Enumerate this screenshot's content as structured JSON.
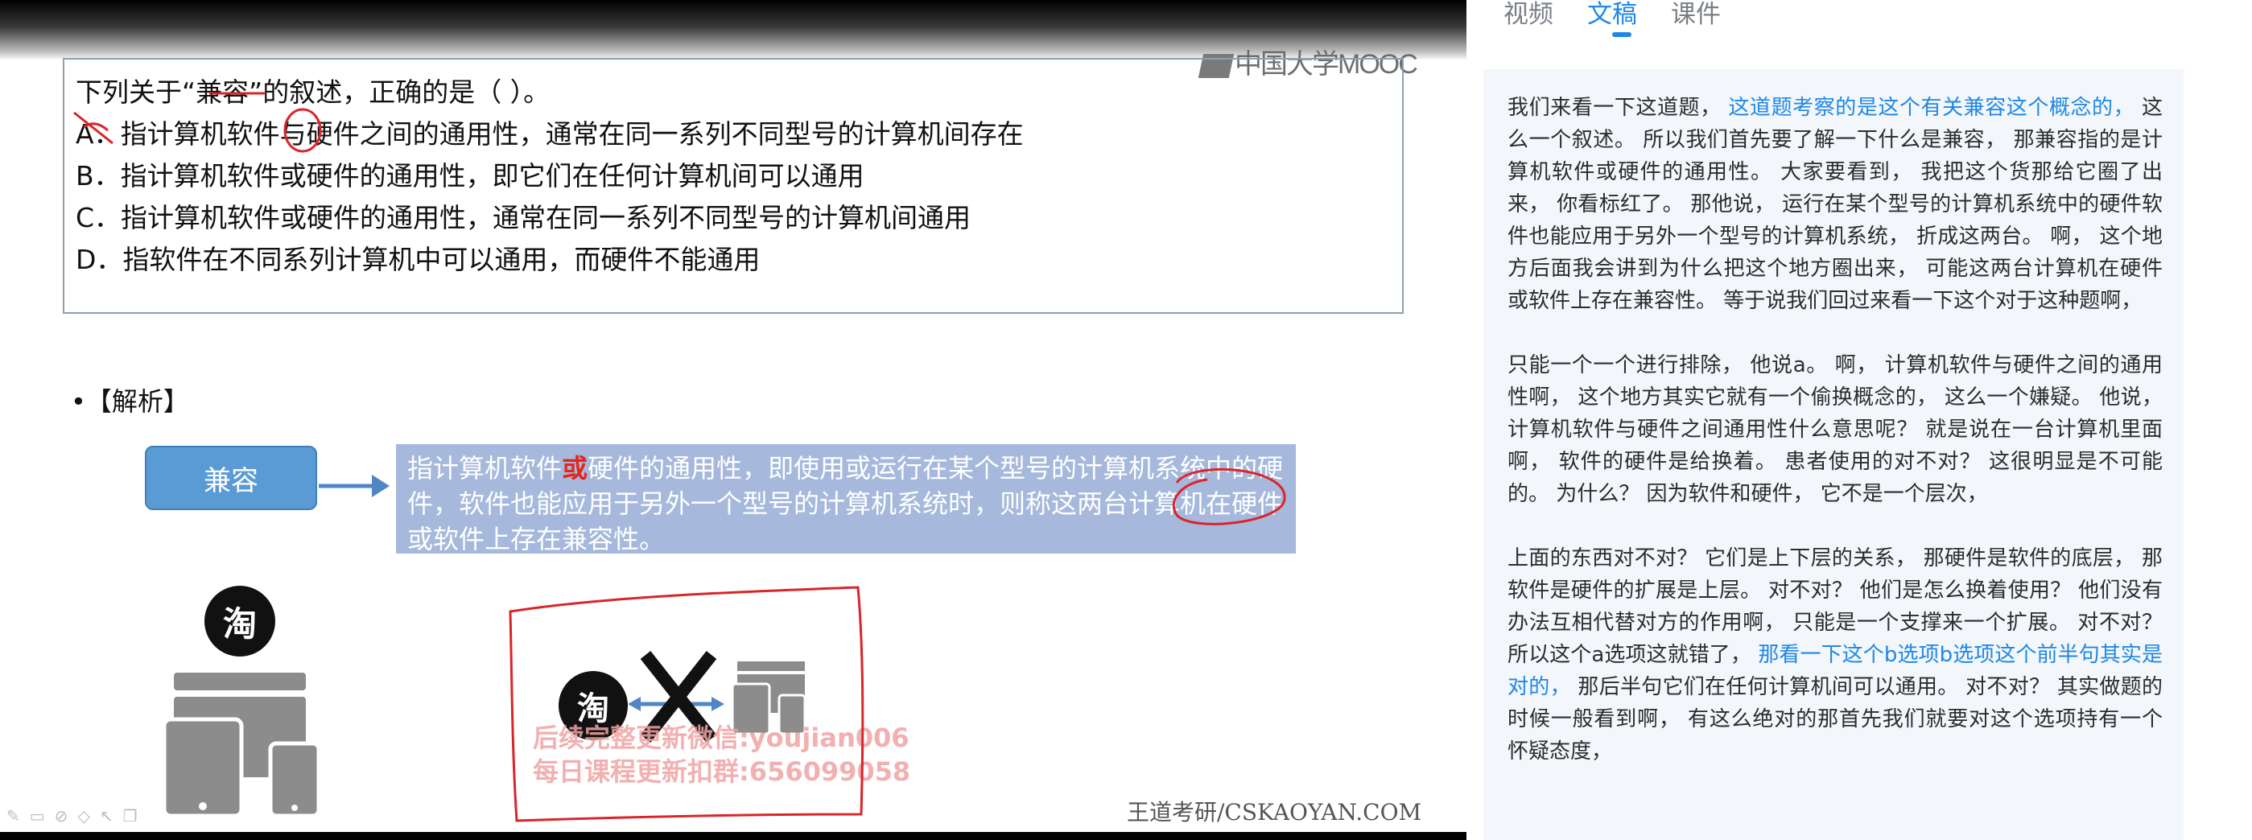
{
  "video": {
    "logo_text": "中国大学MOOC",
    "question": {
      "stem": "下列关于“兼容”的叙述，正确的是（    ）。",
      "options": [
        "A．指计算机软件与硬件之间的通用性，通常在同一系列不同型号的计算机间存在",
        "B．指计算机软件或硬件的通用性，即它们在任何计算机间可以通用",
        "C．指计算机软件或硬件的通用性，通常在同一系列不同型号的计算机间通用",
        "D．指软件在不同系列计算机中可以通用，而硬件不能通用"
      ]
    },
    "analysis_title": "•【解析】",
    "concept_label": "兼容",
    "definition": {
      "part1": "指计算机软件",
      "highlight": "或",
      "part2": "硬件的通用性，即使用或运行在某个型号的计算机系统中的硬件，软件也能应用于另外一个型号的计算机系统时，则称这两台计算机在硬件或软件上存在兼容性。"
    },
    "taobao_glyph": "淘",
    "watermark_lines": [
      "后续完整更新微信:youjian006",
      "每日课程更新扣群:656099058"
    ],
    "site_credit": "王道考研/CSKAOYAN.COM",
    "icon_colors": {
      "device": "#8c8c8c",
      "annotation": "#d9252a",
      "arrow": "#4f86c6"
    }
  },
  "panel": {
    "tabs": [
      {
        "label": "视频",
        "active": false
      },
      {
        "label": "文稿",
        "active": true
      },
      {
        "label": "课件",
        "active": false
      }
    ],
    "transcript": [
      [
        {
          "text": "我们来看一下这道题， ",
          "hl": false
        },
        {
          "text": "这道题考察的是这个有关兼容这个概念的，",
          "hl": true
        },
        {
          "text": " 这么一个叙述。 所以我们首先要了解一下什么是兼容， 那兼容指的是计算机软件或硬件的通用性。 大家要看到， 我把这个货那给它圈了出来， 你看标红了。 那他说， 运行在某个型号的计算机系统中的硬件软件也能应用于另外一个型号的计算机系统， 折成这两台。 啊， 这个地方后面我会讲到为什么把这个地方圈出来， 可能这两台计算机在硬件或软件上存在兼容性。 等于说我们回过来看一下这个对于这种题啊，",
          "hl": false
        }
      ],
      [
        {
          "text": "只能一个一个进行排除， 他说a。 啊， 计算机软件与硬件之间的通用性啊， 这个地方其实它就有一个偷换概念的， 这么一个嫌疑。 他说， 计算机软件与硬件之间通用性什么意思呢？ 就是说在一台计算机里面啊， 软件的硬件是给换着。 患者使用的对不对？ 这很明显是不可能的。 为什么？ 因为软件和硬件， 它不是一个层次，",
          "hl": false
        }
      ],
      [
        {
          "text": "上面的东西对不对？ 它们是上下层的关系， 那硬件是软件的底层， 那软件是硬件的扩展是上层。 对不对？ 他们是怎么换着使用？ 他们没有办法互相代替对方的作用啊， 只能是一个支撑来一个扩展。 对不对？ 所以这个a选项这就错了， ",
          "hl": false
        },
        {
          "text": "那看一下这个b选项b选项这个前半句其实是对的，",
          "hl": true
        },
        {
          "text": " 那后半句它们在任何计算机间可以通用。 对不对？ 其实做题的时候一般看到啊， 有这么绝对的那首先我们就要对这个选项持有一个怀疑态度，",
          "hl": false
        }
      ]
    ]
  }
}
